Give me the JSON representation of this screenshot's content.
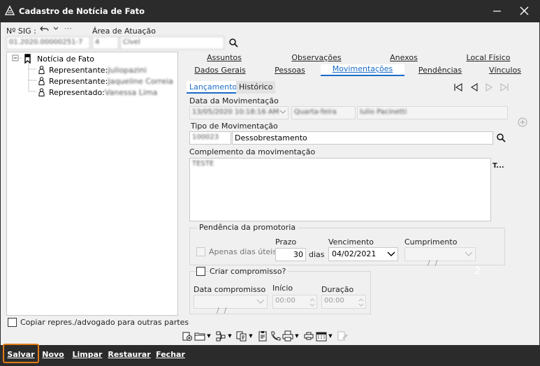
{
  "window": {
    "title": "Cadastro de Notícia de Fato",
    "close_glyph": "✕",
    "minimize_glyph": "—"
  },
  "header": {
    "sig_label": "Nº SIG :",
    "sig_value": "01.2020.00000251-7",
    "area_label": "Área de Atuação",
    "area_code": "4",
    "area_name": "Cível"
  },
  "tree": {
    "root": "Notícia de Fato",
    "children": [
      {
        "label": "Representante:",
        "name": "Juliopazini"
      },
      {
        "label": "Representante:",
        "name": "Jaqueline Correia"
      },
      {
        "label": "Representado:",
        "name": "Vanessa Lima"
      }
    ]
  },
  "copy_checkbox_label": "Copiar repres./advogado para outras partes",
  "tabs": {
    "row1": [
      "Assuntos",
      "Observações",
      "Anexos",
      "Local Físico"
    ],
    "row2": [
      "Dados Gerais",
      "Pessoas",
      "Movimentações",
      "Pendências",
      "Vínculos"
    ],
    "active": "Movimentações"
  },
  "subtabs": {
    "items": [
      "Lançamento",
      "Histórico"
    ],
    "active": "Lançamento"
  },
  "movement": {
    "date_label": "Data da Movimentação",
    "date_value": "13/05/2020 10:18:16 AM",
    "weekday_value": "Quarta-feira",
    "user_value": "Iulio Pacinetti",
    "type_label": "Tipo de Movimentação",
    "type_code": "100023",
    "type_name": "Dessobrestamento",
    "complement_label": "Complemento da movimentação",
    "complement_value": "TESTE",
    "format_glyph": "T..."
  },
  "pendency": {
    "group_title": "Pendência da promotoria",
    "only_working_days_label": "Apenas dias úteis?",
    "prazo_label": "Prazo",
    "prazo_value": "30",
    "dias_label": "dias",
    "vencimento_label": "Vencimento",
    "vencimento_value": "04/02/2021",
    "cumprimento_label": "Cumprimento",
    "cumprimento_value": "  /  /",
    "side_number": "2"
  },
  "commitment": {
    "checkbox_label": "Criar compromisso?",
    "date_label": "Data compromisso",
    "date_value": "  /  /",
    "inicio_label": "Início",
    "inicio_value": "00:00",
    "duracao_label": "Duração",
    "duracao_value": "00:00"
  },
  "footer": {
    "buttons": [
      "Salvar",
      "Novo",
      "Limpar",
      "Restaurar",
      "Fechar"
    ]
  },
  "colors": {
    "accent": "#1a6cc8",
    "highlight": "#e07b18",
    "dark": "#2b2b2b"
  }
}
